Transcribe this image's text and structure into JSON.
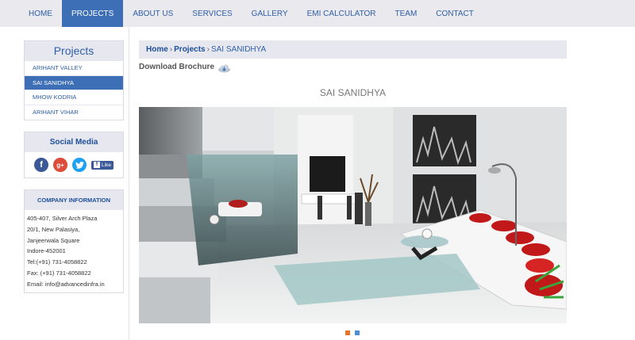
{
  "nav": {
    "items": [
      {
        "label": "HOME"
      },
      {
        "label": "PROJECTS"
      },
      {
        "label": "ABOUT US"
      },
      {
        "label": "SERVICES"
      },
      {
        "label": "GALLERY"
      },
      {
        "label": "EMI CALCULATOR"
      },
      {
        "label": "TEAM"
      },
      {
        "label": "CONTACT"
      }
    ],
    "active_index": 1
  },
  "sidebar": {
    "projects_title": "Projects",
    "projects": [
      {
        "label": "ARIHANT VALLEY"
      },
      {
        "label": "SAI SANIDHYA"
      },
      {
        "label": "MHOW KODRIA"
      },
      {
        "label": "ARIHANT VIHAR"
      }
    ],
    "active_project_index": 1,
    "social_title": "Social Media",
    "social": {
      "facebook_icon": "f",
      "google_plus_icon": "g+",
      "twitter_icon": "twitter-bird-icon",
      "like_label": "Like"
    },
    "company_title": "COMPANY INFORMATION",
    "company_lines": [
      "405-407, Silver Arch Plaza",
      "20/1, New Palasiya,",
      "Janjeerwala Square",
      "Indore-452001",
      "Tel:(+91) 731-4058822",
      "Fax: (+91) 731-4058822",
      "Email: info@advancedinfra.in"
    ]
  },
  "breadcrumb": {
    "home": "Home",
    "sep": "›",
    "projects": "Projects",
    "current": "SAI SANIDHYA"
  },
  "download": {
    "label": "Download Brochure",
    "icon": "cloud-download-icon"
  },
  "main": {
    "project_title": "SAI SANIDHYA"
  },
  "slider": {
    "dots": [
      {
        "color": "#e8742a",
        "active": true
      },
      {
        "color": "#4a90d9",
        "active": false
      }
    ]
  },
  "colors": {
    "accent": "#3c6fb6",
    "link": "#2f5fa8",
    "panel": "#e6e7ef"
  }
}
